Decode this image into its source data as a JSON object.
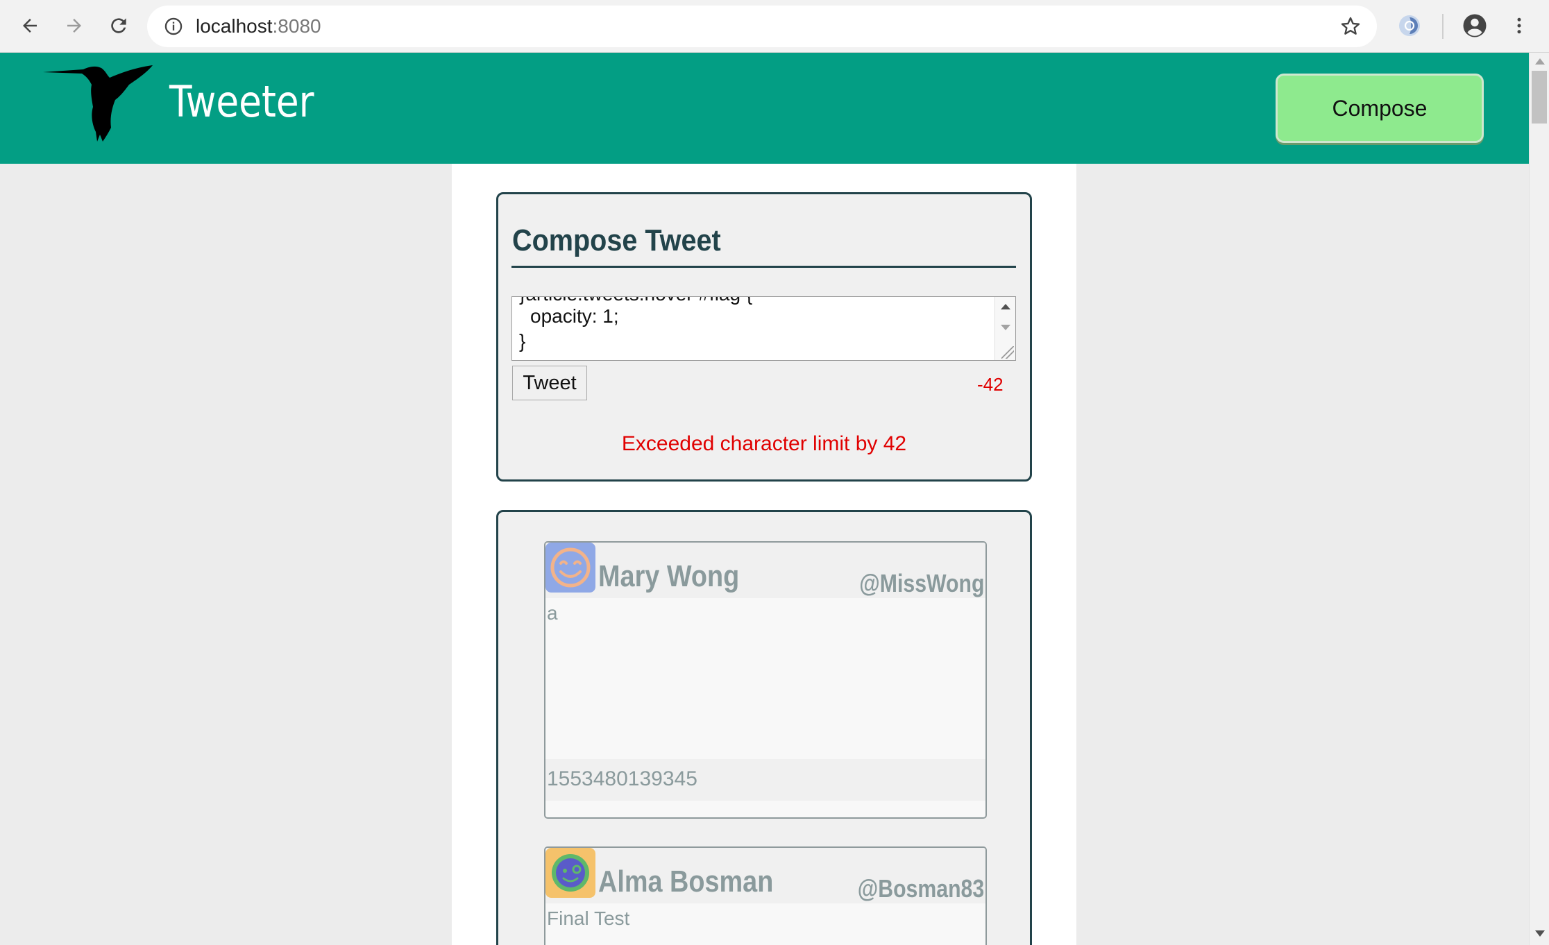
{
  "browser": {
    "url_host": "localhost",
    "url_port": ":8080"
  },
  "header": {
    "brand": "Tweeter",
    "compose_label": "Compose",
    "brand_color": "#039e84",
    "compose_color": "#8eea8e"
  },
  "compose": {
    "title": "Compose Tweet",
    "textarea_lines": [
      "}article.tweets:hover #flag {",
      "  opacity: 1;",
      "}"
    ],
    "tweet_button": "Tweet",
    "counter": "-42",
    "error": "Exceeded character limit by 42",
    "error_color": "#e00000"
  },
  "feed": {
    "tweets": [
      {
        "name": "Mary Wong",
        "handle": "@MissWong",
        "text": "a",
        "timestamp": "1553480139345",
        "avatar_icon": "smiley-face-icon"
      },
      {
        "name": "Alma Bosman",
        "handle": "@Bosman83",
        "text": "Final Test",
        "timestamp": "",
        "avatar_icon": "winking-face-icon"
      }
    ]
  }
}
